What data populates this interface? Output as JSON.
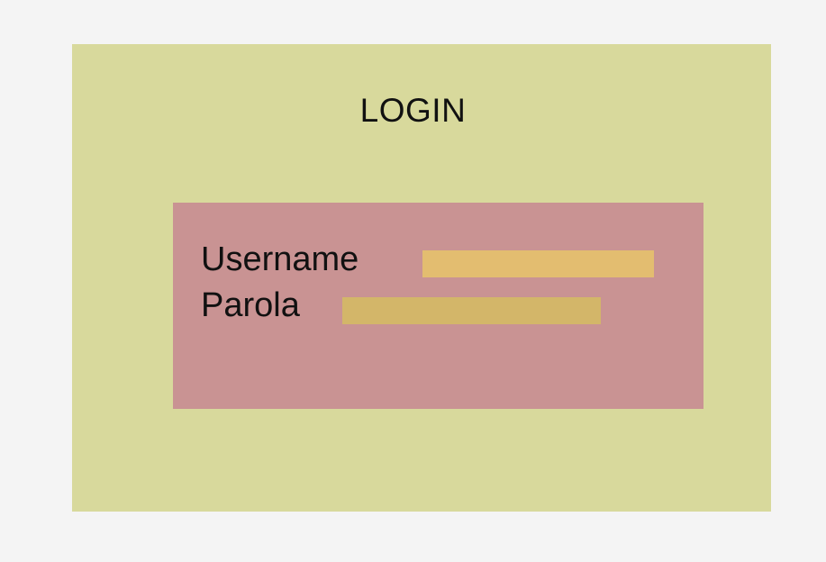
{
  "login": {
    "title": "LOGIN",
    "username_label": "Username",
    "username_value": "",
    "password_label": "Parola",
    "password_value": ""
  },
  "colors": {
    "page_background": "#f4f4f4",
    "outer_panel": "#d8d99c",
    "form_panel": "#c99393",
    "username_input": "#e3bd70",
    "password_input": "#d3b669",
    "text": "#111111"
  }
}
